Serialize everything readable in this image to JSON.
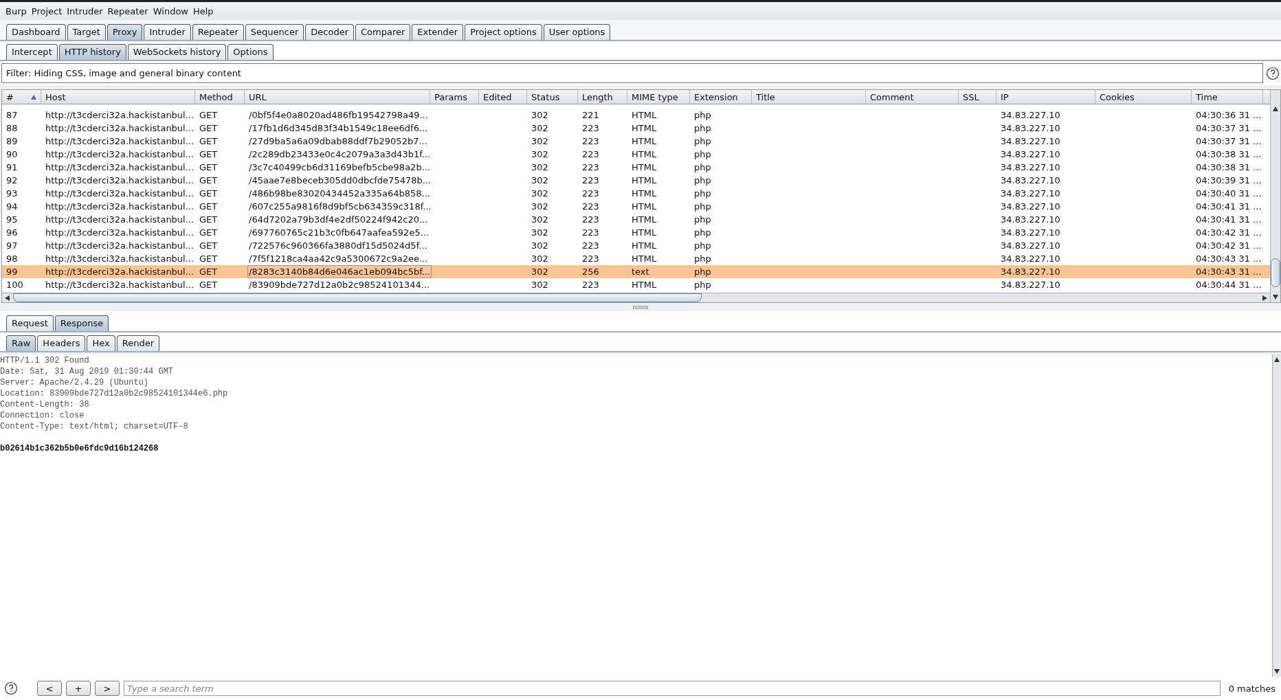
{
  "menu_bar": [
    "Burp",
    "Project",
    "Intruder",
    "Repeater",
    "Window",
    "Help"
  ],
  "main_tabs": [
    {
      "label": "Dashboard",
      "selected": false
    },
    {
      "label": "Target",
      "selected": false
    },
    {
      "label": "Proxy",
      "selected": true
    },
    {
      "label": "Intruder",
      "selected": false
    },
    {
      "label": "Repeater",
      "selected": false
    },
    {
      "label": "Sequencer",
      "selected": false
    },
    {
      "label": "Decoder",
      "selected": false
    },
    {
      "label": "Comparer",
      "selected": false
    },
    {
      "label": "Extender",
      "selected": false
    },
    {
      "label": "Project options",
      "selected": false
    },
    {
      "label": "User options",
      "selected": false
    }
  ],
  "sub_tabs": [
    {
      "label": "Intercept",
      "selected": false
    },
    {
      "label": "HTTP history",
      "selected": true
    },
    {
      "label": "WebSockets history",
      "selected": false
    },
    {
      "label": "Options",
      "selected": false
    }
  ],
  "filter": "Filter: Hiding CSS, image and general binary content",
  "table": {
    "columns": [
      {
        "label": "#",
        "sorted": true
      },
      {
        "label": "Host",
        "sorted": false
      },
      {
        "label": "Method",
        "sorted": false
      },
      {
        "label": "URL",
        "sorted": false
      },
      {
        "label": "Params",
        "sorted": false
      },
      {
        "label": "Edited",
        "sorted": false
      },
      {
        "label": "Status",
        "sorted": false
      },
      {
        "label": "Length",
        "sorted": false
      },
      {
        "label": "MIME type",
        "sorted": false
      },
      {
        "label": "Extension",
        "sorted": false
      },
      {
        "label": "Title",
        "sorted": false
      },
      {
        "label": "Comment",
        "sorted": false
      },
      {
        "label": "SSL",
        "sorted": false
      },
      {
        "label": "IP",
        "sorted": false
      },
      {
        "label": "Cookies",
        "sorted": false
      },
      {
        "label": "Time",
        "sorted": false
      }
    ],
    "rows": [
      {
        "cells": [
          "87",
          "http://t3cderci32a.hackistanbul...",
          "GET",
          "/0bf5f4e0a8020ad486fb19542798a49...",
          "",
          "",
          "302",
          "221",
          "HTML",
          "php",
          "",
          "",
          "",
          "34.83.227.10",
          "",
          "04:30:36 31 ..."
        ],
        "selected": false
      },
      {
        "cells": [
          "88",
          "http://t3cderci32a.hackistanbul...",
          "GET",
          "/17fb1d6d345d83f34b1549c18ee6df6...",
          "",
          "",
          "302",
          "223",
          "HTML",
          "php",
          "",
          "",
          "",
          "34.83.227.10",
          "",
          "04:30:37 31 ..."
        ],
        "selected": false
      },
      {
        "cells": [
          "89",
          "http://t3cderci32a.hackistanbul...",
          "GET",
          "/27d9ba5a6a09dbab88ddf7b29052b7...",
          "",
          "",
          "302",
          "223",
          "HTML",
          "php",
          "",
          "",
          "",
          "34.83.227.10",
          "",
          "04:30:37 31 ..."
        ],
        "selected": false
      },
      {
        "cells": [
          "90",
          "http://t3cderci32a.hackistanbul...",
          "GET",
          "/2c289db23433e0c4c2079a3a3d43b1f...",
          "",
          "",
          "302",
          "223",
          "HTML",
          "php",
          "",
          "",
          "",
          "34.83.227.10",
          "",
          "04:30:38 31 ..."
        ],
        "selected": false
      },
      {
        "cells": [
          "91",
          "http://t3cderci32a.hackistanbul...",
          "GET",
          "/3c7c40499cb6d31169befb5cbe98a2b...",
          "",
          "",
          "302",
          "223",
          "HTML",
          "php",
          "",
          "",
          "",
          "34.83.227.10",
          "",
          "04:30:38 31 ..."
        ],
        "selected": false
      },
      {
        "cells": [
          "92",
          "http://t3cderci32a.hackistanbul...",
          "GET",
          "/45aae7e8beceb305dd0dbcfde75478b...",
          "",
          "",
          "302",
          "223",
          "HTML",
          "php",
          "",
          "",
          "",
          "34.83.227.10",
          "",
          "04:30:39 31 ..."
        ],
        "selected": false
      },
      {
        "cells": [
          "93",
          "http://t3cderci32a.hackistanbul...",
          "GET",
          "/486b98be83020434452a335a64b858...",
          "",
          "",
          "302",
          "223",
          "HTML",
          "php",
          "",
          "",
          "",
          "34.83.227.10",
          "",
          "04:30:40 31 ..."
        ],
        "selected": false
      },
      {
        "cells": [
          "94",
          "http://t3cderci32a.hackistanbul...",
          "GET",
          "/607c255a9816f8d9bf5cb634359c318f...",
          "",
          "",
          "302",
          "223",
          "HTML",
          "php",
          "",
          "",
          "",
          "34.83.227.10",
          "",
          "04:30:41 31 ..."
        ],
        "selected": false
      },
      {
        "cells": [
          "95",
          "http://t3cderci32a.hackistanbul...",
          "GET",
          "/64d7202a79b3df4e2df50224f942c20...",
          "",
          "",
          "302",
          "223",
          "HTML",
          "php",
          "",
          "",
          "",
          "34.83.227.10",
          "",
          "04:30:41 31 ..."
        ],
        "selected": false
      },
      {
        "cells": [
          "96",
          "http://t3cderci32a.hackistanbul...",
          "GET",
          "/697760765c21b3c0fb647aafea592e5...",
          "",
          "",
          "302",
          "223",
          "HTML",
          "php",
          "",
          "",
          "",
          "34.83.227.10",
          "",
          "04:30:42 31 ..."
        ],
        "selected": false
      },
      {
        "cells": [
          "97",
          "http://t3cderci32a.hackistanbul...",
          "GET",
          "/722576c960366fa3880df15d5024d5f...",
          "",
          "",
          "302",
          "223",
          "HTML",
          "php",
          "",
          "",
          "",
          "34.83.227.10",
          "",
          "04:30:42 31 ..."
        ],
        "selected": false
      },
      {
        "cells": [
          "98",
          "http://t3cderci32a.hackistanbul...",
          "GET",
          "/7f5f1218ca4aa42c9a5300672c9a2ee...",
          "",
          "",
          "302",
          "223",
          "HTML",
          "php",
          "",
          "",
          "",
          "34.83.227.10",
          "",
          "04:30:43 31 ..."
        ],
        "selected": false
      },
      {
        "cells": [
          "99",
          "http://t3cderci32a.hackistanbul...",
          "GET",
          "/8283c3140b84d6e046ac1eb094bc5bf...",
          "",
          "",
          "302",
          "256",
          "text",
          "php",
          "",
          "",
          "",
          "34.83.227.10",
          "",
          "04:30:43 31 ..."
        ],
        "selected": true
      },
      {
        "cells": [
          "100",
          "http://t3cderci32a.hackistanbul...",
          "GET",
          "/83909bde727d12a0b2c98524101344...",
          "",
          "",
          "302",
          "223",
          "HTML",
          "php",
          "",
          "",
          "",
          "34.83.227.10",
          "",
          "04:30:44 31 ..."
        ],
        "selected": false
      }
    ]
  },
  "message_tabs": [
    {
      "label": "Request",
      "selected": false
    },
    {
      "label": "Response",
      "selected": true
    }
  ],
  "view_tabs": [
    {
      "label": "Raw",
      "selected": true
    },
    {
      "label": "Headers",
      "selected": false
    },
    {
      "label": "Hex",
      "selected": false
    },
    {
      "label": "Render",
      "selected": false
    }
  ],
  "response": [
    {
      "kind": "header",
      "text": "HTTP/1.1 302 Found"
    },
    {
      "kind": "header",
      "text": "Date: Sat, 31 Aug 2019 01:30:44 GMT"
    },
    {
      "kind": "header",
      "text": "Server: Apache/2.4.29 (Ubuntu)"
    },
    {
      "kind": "header",
      "text": "Location: 83909bde727d12a0b2c98524101344e6.php"
    },
    {
      "kind": "header",
      "text": "Content-Length: 38"
    },
    {
      "kind": "header",
      "text": "Connection: close"
    },
    {
      "kind": "header",
      "text": "Content-Type: text/html; charset=UTF-8"
    },
    {
      "kind": "body",
      "text": "b02614b1c362b5b0e6fdc9d16b124268"
    }
  ],
  "search_bar": {
    "buttons": [
      "<",
      "+",
      ">"
    ],
    "placeholder": "Type a search term",
    "matches": "0 matches"
  }
}
